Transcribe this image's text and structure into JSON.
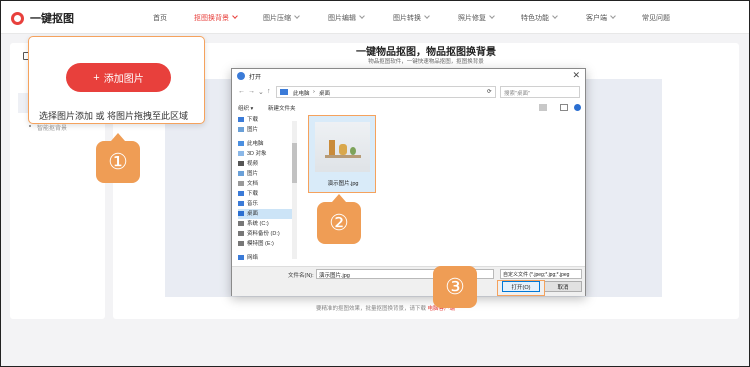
{
  "brand": {
    "name": "一键抠图",
    "logo_color": "#e8403c"
  },
  "nav": {
    "items": [
      {
        "label": "首页",
        "has_dropdown": false,
        "active": false
      },
      {
        "label": "抠图换背景",
        "has_dropdown": true,
        "active": true
      },
      {
        "label": "图片压缩",
        "has_dropdown": true,
        "active": false
      },
      {
        "label": "图片编辑",
        "has_dropdown": true,
        "active": false
      },
      {
        "label": "图片转换",
        "has_dropdown": true,
        "active": false
      },
      {
        "label": "照片修复",
        "has_dropdown": true,
        "active": false
      },
      {
        "label": "特色功能",
        "has_dropdown": true,
        "active": false
      },
      {
        "label": "客户端",
        "has_dropdown": true,
        "active": false
      },
      {
        "label": "常见问题",
        "has_dropdown": false,
        "active": false
      }
    ]
  },
  "sidebar": {
    "sub_label": "智能抠背景"
  },
  "main": {
    "title": "一键物品抠图，物品抠图换背景",
    "subtitle": "物品抠图软件，一键快速物品抠图，抠图换背景",
    "footer_text": "要精准的抠图效果，批量抠图换背景，请下载",
    "footer_link": "电脑客户端"
  },
  "popup": {
    "add_button_label": "添加图片",
    "hint": "选择图片添加 或 将图片拖拽至此区域"
  },
  "steps": [
    "①",
    "②",
    "③"
  ],
  "dialog": {
    "title": "打开",
    "close_glyph": "✕",
    "address": {
      "part1": "此电脑",
      "separator": "›",
      "part2": "桌面"
    },
    "search_placeholder": "搜索\"桌面\"",
    "toolbar": {
      "organize": "组织 ▾",
      "new_folder": "新建文件夹"
    },
    "tree": [
      {
        "label": "下载",
        "icon": "download-icon",
        "selected": false
      },
      {
        "label": "图片",
        "icon": "pictures-icon",
        "selected": false
      },
      {
        "label": "此电脑",
        "icon": "computer-icon",
        "selected": false
      },
      {
        "label": "3D 对象",
        "icon": "cube-icon",
        "selected": false
      },
      {
        "label": "视频",
        "icon": "video-icon",
        "selected": false
      },
      {
        "label": "图片",
        "icon": "pictures-icon",
        "selected": false
      },
      {
        "label": "文档",
        "icon": "document-icon",
        "selected": false
      },
      {
        "label": "下载",
        "icon": "download-icon",
        "selected": false
      },
      {
        "label": "音乐",
        "icon": "music-icon",
        "selected": false
      },
      {
        "label": "桌面",
        "icon": "desktop-icon",
        "selected": true
      },
      {
        "label": "系统 (C:)",
        "icon": "drive-icon",
        "selected": false
      },
      {
        "label": "资料备份 (D:)",
        "icon": "drive-icon",
        "selected": false
      },
      {
        "label": "模特图 (E:)",
        "icon": "drive-icon",
        "selected": false
      },
      {
        "label": "网络",
        "icon": "network-icon",
        "selected": false
      }
    ],
    "file": {
      "label": "演示图片.jpg"
    },
    "filename_label": "文件名(N):",
    "filename_value": "演示图片.jpg",
    "filetype_value": "自定义文件 (*.jpeg;*.jpg;*.jpeg",
    "open_button": "打开(O)",
    "cancel_button": "取消"
  }
}
